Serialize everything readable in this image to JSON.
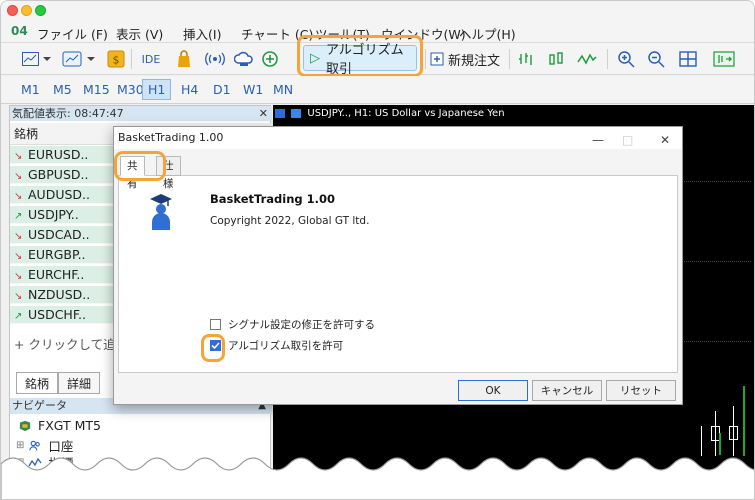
{
  "menu": {
    "logo": "04",
    "items": [
      "ファイル (F)",
      "表示 (V)",
      "挿入(I)",
      "チャート (C)",
      "ツール(T)",
      "ウインドウ(W)",
      "ヘルプ(H)"
    ]
  },
  "toolbar": {
    "ide_label": "IDE",
    "algo_label": "アルゴリズム取引",
    "new_order_label": "新規注文"
  },
  "timeframes": [
    "M1",
    "M5",
    "M15",
    "M30",
    "H1",
    "H4",
    "D1",
    "W1",
    "MN"
  ],
  "timeframe_active": "H1",
  "market_watch": {
    "header": "気配値表示: 08:47:47",
    "column_header": "銘柄",
    "symbols": [
      {
        "name": "EURUSD..",
        "dir": "down"
      },
      {
        "name": "GBPUSD..",
        "dir": "down"
      },
      {
        "name": "AUDUSD..",
        "dir": "down"
      },
      {
        "name": "USDJPY..",
        "dir": "up"
      },
      {
        "name": "USDCAD..",
        "dir": "down"
      },
      {
        "name": "EURGBP..",
        "dir": "down"
      },
      {
        "name": "EURCHF..",
        "dir": "down"
      },
      {
        "name": "NZDUSD..",
        "dir": "down"
      },
      {
        "name": "USDCHF..",
        "dir": "up"
      }
    ],
    "add_label": "+ クリックして追加",
    "tabs": [
      "銘柄",
      "詳細"
    ]
  },
  "navigator": {
    "header": "ナビゲータ",
    "items": [
      "FXGT MT5",
      "口座",
      "指標"
    ]
  },
  "chart": {
    "title": "USDJPY.., H1:  US Dollar vs Japanese Yen"
  },
  "dialog": {
    "title": "BasketTrading 1.00",
    "tabs": [
      "共有",
      "仕様"
    ],
    "ea_name": "BasketTrading 1.00",
    "copyright": "Copyright 2022, Global GT ltd.",
    "checkboxes": [
      {
        "label": "シグナル設定の修正を許可する",
        "checked": false
      },
      {
        "label": "アルゴリズム取引を許可",
        "checked": true
      }
    ],
    "buttons": {
      "ok": "OK",
      "cancel": "キャンセル",
      "reset": "リセット"
    },
    "controls": {
      "minimize": "—",
      "maximize": "□",
      "close": "✕"
    }
  },
  "colors": {
    "highlight": "#f5a43a",
    "accent_blue": "#2a5fb5",
    "up": "#1c9c3c",
    "down": "#d23b3b"
  }
}
